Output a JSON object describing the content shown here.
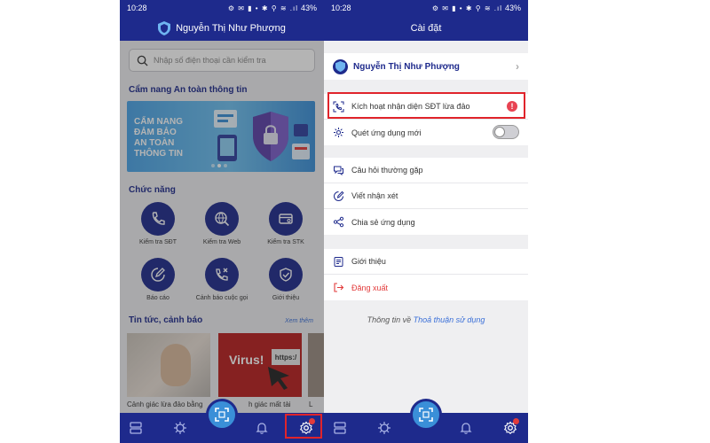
{
  "left_screen": {
    "status": {
      "time": "10:28",
      "icons": "⚙ ✉ ▮ • ✱ ⚲ ≋ .ıl",
      "battery": "43%"
    },
    "appbar_title": "Nguyễn Thị Như Phượng",
    "search": {
      "placeholder": "Nhập số điện thoại cần kiểm tra"
    },
    "guide_title": "Cẩm nang An toàn thông tin",
    "banner_lines": [
      "CẨM NANG",
      "ĐẢM BẢO",
      "AN TOÀN",
      "THÔNG TIN"
    ],
    "functions_title": "Chức năng",
    "functions": [
      {
        "label": "Kiểm tra SĐT",
        "icon": "phone-icon"
      },
      {
        "label": "Kiểm tra Web",
        "icon": "web-search-icon"
      },
      {
        "label": "Kiểm tra STK",
        "icon": "bank-card-icon"
      },
      {
        "label": "Báo cáo",
        "icon": "report-icon"
      },
      {
        "label": "Cảnh báo cuộc gọi",
        "icon": "call-warning-icon"
      },
      {
        "label": "Giới thiệu",
        "icon": "shield-info-icon"
      }
    ],
    "news_title": "Tin tức, cảnh báo",
    "news_more": "Xem thêm",
    "news": [
      {
        "caption": "Cảnh giác lừa đảo bằng"
      },
      {
        "caption": "h giác mất tài"
      },
      {
        "caption": "L"
      }
    ],
    "virus_text": "Virus!",
    "virus_tag": "https:/",
    "bottom_badge_color": "#e23b3b"
  },
  "right_screen": {
    "status": {
      "time": "10:28",
      "icons": "⚙ ✉ ▮ • ✱ ⚲ ≋ .ıl",
      "battery": "43%"
    },
    "appbar_title": "Cài đặt",
    "profile_name": "Nguyễn Thị Như Phượng",
    "profile_chevron": "›",
    "group1": [
      {
        "label": "Kích hoạt nhận diện SĐT lừa đảo",
        "icon": "phone-scan-icon",
        "badge": "!"
      },
      {
        "label": "Quét ứng dụng mới",
        "icon": "gear-scan-icon",
        "toggle": false
      }
    ],
    "group2": [
      {
        "label": "Câu hỏi thường gặp",
        "icon": "faq-icon"
      },
      {
        "label": "Viết nhận xét",
        "icon": "edit-icon"
      },
      {
        "label": "Chia sẻ ứng dụng",
        "icon": "share-icon"
      }
    ],
    "group3": [
      {
        "label": "Giới thiệu",
        "icon": "info-icon"
      },
      {
        "label": "Đăng xuất",
        "icon": "logout-icon"
      }
    ],
    "terms_prefix": "Thông tin về",
    "terms_link": "Thoả thuận sử dụng"
  },
  "colors": {
    "primary": "#1e2a8c",
    "highlight": "#e0242b",
    "danger": "#e23b3b",
    "link": "#3a6fd8"
  }
}
